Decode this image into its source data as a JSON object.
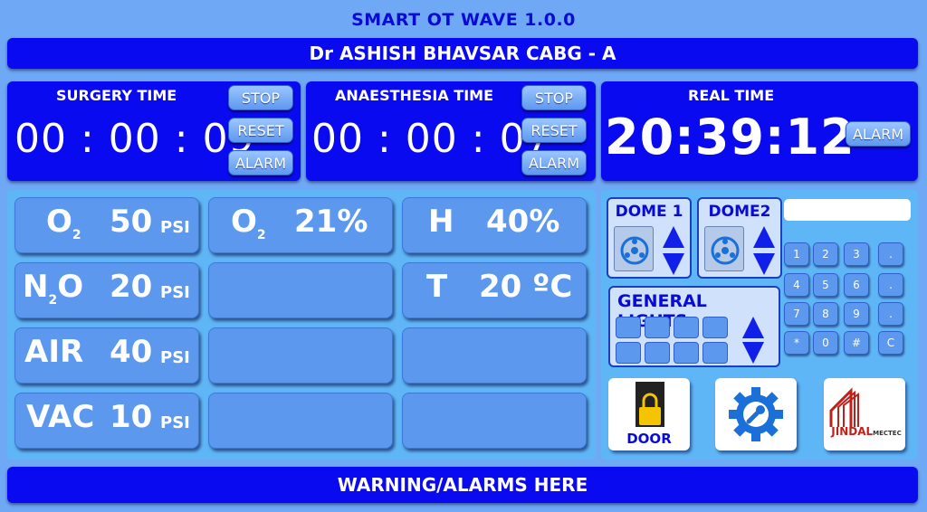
{
  "app": {
    "title": "SMART OT WAVE 1.0.0"
  },
  "surgeon_bar": {
    "text": "Dr ASHISH BHAVSAR CABG - A"
  },
  "surgery_timer": {
    "label": "SURGERY TIME",
    "value": "00 : 00 : 09",
    "stop": "STOP",
    "reset": "RESET",
    "alarm": "ALARM"
  },
  "anaesthesia_timer": {
    "label": "ANAESTHESIA TIME",
    "value": "00 : 00 : 07",
    "stop": "STOP",
    "reset": "RESET",
    "alarm": "ALARM"
  },
  "real_time": {
    "label": "REAL TIME",
    "value": "20:39:12",
    "alarm": "ALARM"
  },
  "gas": {
    "o2": {
      "name": "O",
      "sub": "2",
      "value": "50",
      "unit": "PSI"
    },
    "n2o": {
      "name1": "N",
      "sub": "2",
      "name2": "O",
      "value": "20",
      "unit": "PSI"
    },
    "air": {
      "name": "AIR",
      "value": "40",
      "unit": "PSI"
    },
    "vac": {
      "name": "VAC",
      "value": "10",
      "unit": "PSI"
    }
  },
  "o2_percent": {
    "name": "O",
    "sub": "2",
    "value": "21%"
  },
  "humidity": {
    "name": "H",
    "value": "40%"
  },
  "temperature": {
    "name": "T",
    "value": "20 ºC"
  },
  "dome1": {
    "label": "DOME 1"
  },
  "dome2": {
    "label": "DOME2"
  },
  "general_lights": {
    "label": "GENERAL LIGHTS"
  },
  "keypad": {
    "keys": [
      "1",
      "2",
      "3",
      ".",
      "4",
      "5",
      "6",
      ".",
      "7",
      "8",
      "9",
      ".",
      "*",
      "0",
      "#",
      "C"
    ]
  },
  "door": {
    "label": "DOOR"
  },
  "logo": {
    "brand": "JINDAL",
    "sub": "MECTEC"
  },
  "warning_bar": {
    "text": "WARNING/ALARMS HERE"
  },
  "colors": {
    "panel": "#0a0af0",
    "background": "#6fa8f5",
    "tile": "#5d98ef",
    "accent_text": "#0a0ad6",
    "icon_blue": "#1a6fd8",
    "lock_yellow": "#f5c400"
  }
}
